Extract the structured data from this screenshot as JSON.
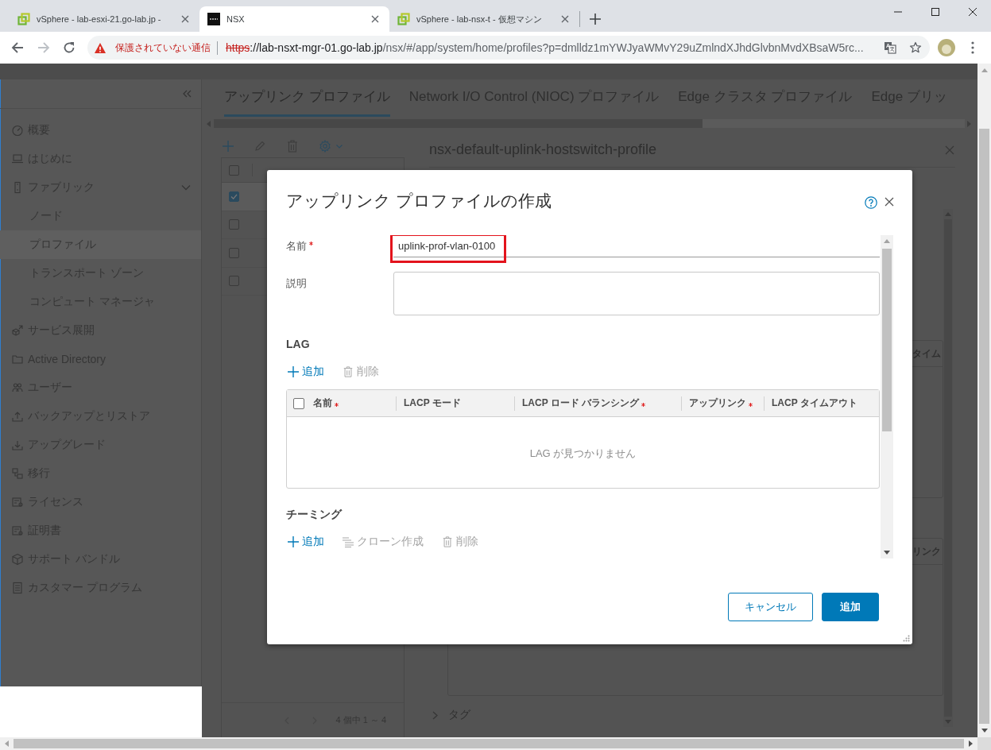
{
  "browser": {
    "tabs": [
      {
        "title": "vSphere - lab-esxi-21.go-lab.jp -",
        "kind": "squares",
        "selected": false
      },
      {
        "title": "NSX",
        "kind": "tile",
        "selected": true
      },
      {
        "title": "vSphere - lab-nsx-t - 仮想マシン",
        "kind": "squares",
        "selected": false
      }
    ],
    "address": {
      "security": "保護されていない通信",
      "scheme": "https",
      "host": "://lab-nsxt-mgr-01.go-lab.jp",
      "path": "/nsx/#/app/system/home/profiles?p=dmlldz1mYWJyaWMvY29uZmlndXJhdGlvbnMvdXBsaW5rc..."
    }
  },
  "sidebar": {
    "items": [
      {
        "label": "概要",
        "selected": false
      },
      {
        "label": "はじめに",
        "selected": false
      },
      {
        "label": "ファブリック",
        "selected": false,
        "expanded": true,
        "children": [
          {
            "label": "ノード",
            "selected": false
          },
          {
            "label": "プロファイル",
            "selected": true
          },
          {
            "label": "トランスポート ゾーン",
            "selected": false
          },
          {
            "label": "コンピュート マネージャ",
            "selected": false
          }
        ]
      },
      {
        "label": "サービス展開",
        "selected": false
      },
      {
        "label": "Active Directory",
        "selected": false
      },
      {
        "label": "ユーザー",
        "selected": false
      },
      {
        "label": "バックアップとリストア",
        "selected": false
      },
      {
        "label": "アップグレード",
        "selected": false
      },
      {
        "label": "移行",
        "selected": false
      },
      {
        "label": "ライセンス",
        "selected": false
      },
      {
        "label": "証明書",
        "selected": false
      },
      {
        "label": "サポート バンドル",
        "selected": false
      },
      {
        "label": "カスタマー プログラム",
        "selected": false
      }
    ]
  },
  "profile_tabs": [
    {
      "label": "アップリンク プロファイル",
      "selected": true
    },
    {
      "label": "Network I/O Control (NIOC) プロファイル",
      "selected": false
    },
    {
      "label": "Edge クラスタ プロファイル",
      "selected": false
    },
    {
      "label": "Edge ブリッ",
      "selected": false
    }
  ],
  "profile_list": {
    "header_checked": false,
    "rows": [
      {
        "checked": true
      },
      {
        "checked": false
      },
      {
        "checked": false
      },
      {
        "checked": false
      }
    ],
    "pagination": "4 個中 1 ～ 4"
  },
  "detail": {
    "title": "nsx-default-uplink-hostswitch-profile",
    "cards": [
      {
        "header": "タイム"
      },
      {
        "header": "リンク"
      }
    ],
    "tags": {
      "label": "タグ",
      "expanded": false
    }
  },
  "dialog": {
    "title": "アップリンク プロファイルの作成",
    "fields": [
      {
        "label": "名前",
        "kind": "input",
        "required": true,
        "value": "uplink-prof-vlan-0100",
        "highlighted": true
      },
      {
        "label": "説明",
        "kind": "textarea",
        "required": false
      }
    ],
    "sections": [
      {
        "title": "LAG",
        "kind": "table",
        "actions": [
          {
            "label": "追加",
            "kind": "add",
            "disabled": false
          },
          {
            "label": "削除",
            "kind": "delete",
            "disabled": true
          }
        ],
        "header_checked": false,
        "columns": [
          {
            "label": "名前",
            "required": true
          },
          {
            "label": "LACP モード",
            "required": false
          },
          {
            "label": "LACP ロード バランシング",
            "required": true
          },
          {
            "label": "アップリンク",
            "required": true
          },
          {
            "label": "LACP タイムアウト",
            "required": false
          }
        ],
        "empty_message": "LAG が見つかりません"
      },
      {
        "title": "チーミング",
        "kind": "list",
        "actions": [
          {
            "label": "追加",
            "kind": "add",
            "disabled": false
          },
          {
            "label": "クローン作成",
            "kind": "clone",
            "disabled": true
          },
          {
            "label": "削除",
            "kind": "delete",
            "disabled": true
          }
        ]
      }
    ],
    "buttons": [
      {
        "label": "キャンセル",
        "kind": "secondary"
      },
      {
        "label": "追加",
        "kind": "primary"
      }
    ]
  }
}
